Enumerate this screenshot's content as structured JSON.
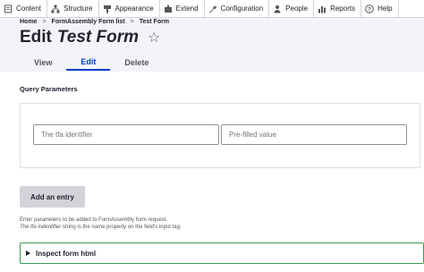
{
  "toolbar": {
    "items": [
      {
        "label": "Content",
        "icon": "content-icon"
      },
      {
        "label": "Structure",
        "icon": "structure-icon"
      },
      {
        "label": "Appearance",
        "icon": "appearance-icon"
      },
      {
        "label": "Extend",
        "icon": "extend-icon"
      },
      {
        "label": "Configuration",
        "icon": "configuration-icon"
      },
      {
        "label": "People",
        "icon": "people-icon"
      },
      {
        "label": "Reports",
        "icon": "reports-icon"
      },
      {
        "label": "Help",
        "icon": "help-icon"
      }
    ]
  },
  "breadcrumb": {
    "home": "Home",
    "list": "FormAssembly Form list",
    "current": "Test Form",
    "separator": ">"
  },
  "page": {
    "title_prefix": "Edit",
    "title_name": "Test Form",
    "star": "☆"
  },
  "tabs": [
    {
      "label": "View",
      "active": false
    },
    {
      "label": "Edit",
      "active": true
    },
    {
      "label": "Delete",
      "active": false
    }
  ],
  "query_parameters": {
    "heading": "Query Parameters",
    "identifier_placeholder": "The tfa identifier",
    "value_placeholder": "Pre-filled value"
  },
  "add_entry_label": "Add an entry",
  "help": {
    "line1": "Enter parameters to be added to FormAssembly form request.",
    "line2_italic": "The tfa indentifier",
    "line2_rest": " string is the name property on the field's input tag."
  },
  "inspect_label": "Inspect form html",
  "colors": {
    "accent": "#003ecc",
    "details_border": "#3a9b53",
    "header_bg": "#f3f4f9"
  }
}
